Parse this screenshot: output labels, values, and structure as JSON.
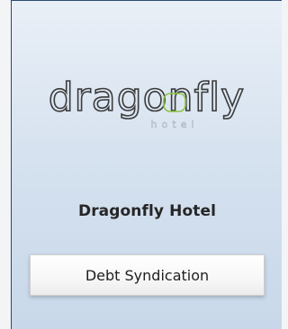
{
  "logo": {
    "wordmark": "dragonfly",
    "subtext": "hotel",
    "accent_color": "#8cc63f",
    "text_color": "#3a3a3a"
  },
  "hotel": {
    "name": "Dragonfly Hotel"
  },
  "actions": {
    "primary_label": "Debt Syndication"
  },
  "colors": {
    "border": "#2c4a6e",
    "panel_top": "#e9eff7",
    "panel_bottom": "#c8d8ea"
  }
}
